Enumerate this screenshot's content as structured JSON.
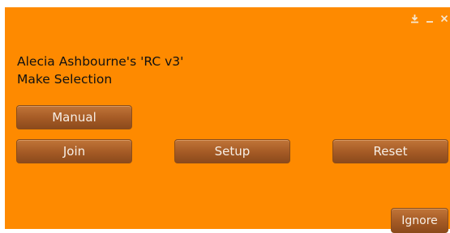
{
  "dialog": {
    "background_color": "#fe8a00",
    "controls": [
      {
        "icon": "download-icon",
        "name": "download-button"
      },
      {
        "icon": "minimize-icon",
        "name": "minimize-button"
      },
      {
        "icon": "close-icon",
        "name": "close-button"
      }
    ],
    "message_line1": "Alecia Ashbourne's 'RC v3'",
    "message_line2": "Make Selection",
    "buttons": {
      "manual": "Manual",
      "join": "Join",
      "setup": "Setup",
      "reset": "Reset",
      "ignore": "Ignore"
    }
  }
}
